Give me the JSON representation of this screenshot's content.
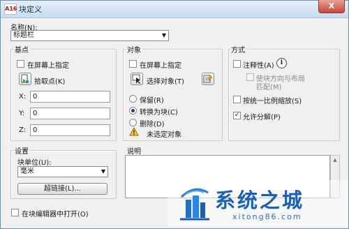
{
  "window": {
    "title": "块定义",
    "app_icon": "A16",
    "close": "X"
  },
  "name": {
    "label": "名称(N):",
    "value": "标题栏"
  },
  "base_point": {
    "title": "基点",
    "specify_on_screen": "在屏幕上指定",
    "pick_point": "拾取点(K)",
    "x_label": "X:",
    "x_value": "0",
    "y_label": "Y:",
    "y_value": "0",
    "z_label": "Z:",
    "z_value": "0"
  },
  "objects": {
    "title": "对象",
    "specify_on_screen": "在屏幕上指定",
    "select_objects": "选择对象(T)",
    "retain": "保留(R)",
    "convert_to_block": "转换为块(C)",
    "delete": "删除(D)",
    "status": "未选定对象"
  },
  "behavior": {
    "title": "方式",
    "annotative": "注释性(A)",
    "match_orientation_line1": "使块方向与布局",
    "match_orientation_line2": "匹配(M)",
    "scale_uniformly": "按统一比例缩放(S)",
    "allow_exploding": "允许分解(P)"
  },
  "settings": {
    "title": "设置",
    "block_unit_label": "块单位(U):",
    "block_unit_value": "毫米",
    "hyperlink": "超链接(L)..."
  },
  "description": {
    "title": "说明"
  },
  "open_in_editor": "在块编辑器中打开(O)",
  "watermark": {
    "title": "系统之城",
    "url": "xitong86.com"
  }
}
